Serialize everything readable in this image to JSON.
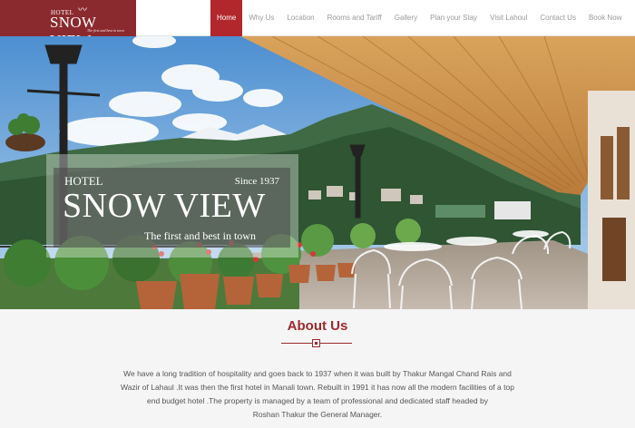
{
  "brand": {
    "hotel_small": "HOTEL",
    "name": "SNOW VIEW",
    "tagline": "The first and best in town"
  },
  "nav": {
    "items": [
      {
        "label": "Home",
        "active": true
      },
      {
        "label": "Why Us"
      },
      {
        "label": "Location"
      },
      {
        "label": "Rooms and Tariff"
      },
      {
        "label": "Gallery"
      },
      {
        "label": "Plan your Stay"
      },
      {
        "label": "Visit Lahoul"
      },
      {
        "label": "Contact Us"
      },
      {
        "label": "Book Now"
      }
    ]
  },
  "hero": {
    "hotel": "HOTEL",
    "since": "Since 1937",
    "name": "SNOW VIEW",
    "tagline": "The first and best in town"
  },
  "about": {
    "title": "About Us",
    "text_lines": [
      "We have a long tradition of hospitality and goes back to 1937 when it was built by Thakur Mangal Chand Rais and",
      "Wazir of Lahaul .It was then the first hotel in Manali town. Rebuilt in 1991 it has now all the modern facilities of a top",
      "end budget hotel .The property is managed by a team of professional and dedicated staff headed by",
      "Roshan Thakur the General Manager."
    ]
  },
  "colors": {
    "brand": "#8b2a2e",
    "active_nav": "#b2272c",
    "heading": "#9b2a2e"
  }
}
